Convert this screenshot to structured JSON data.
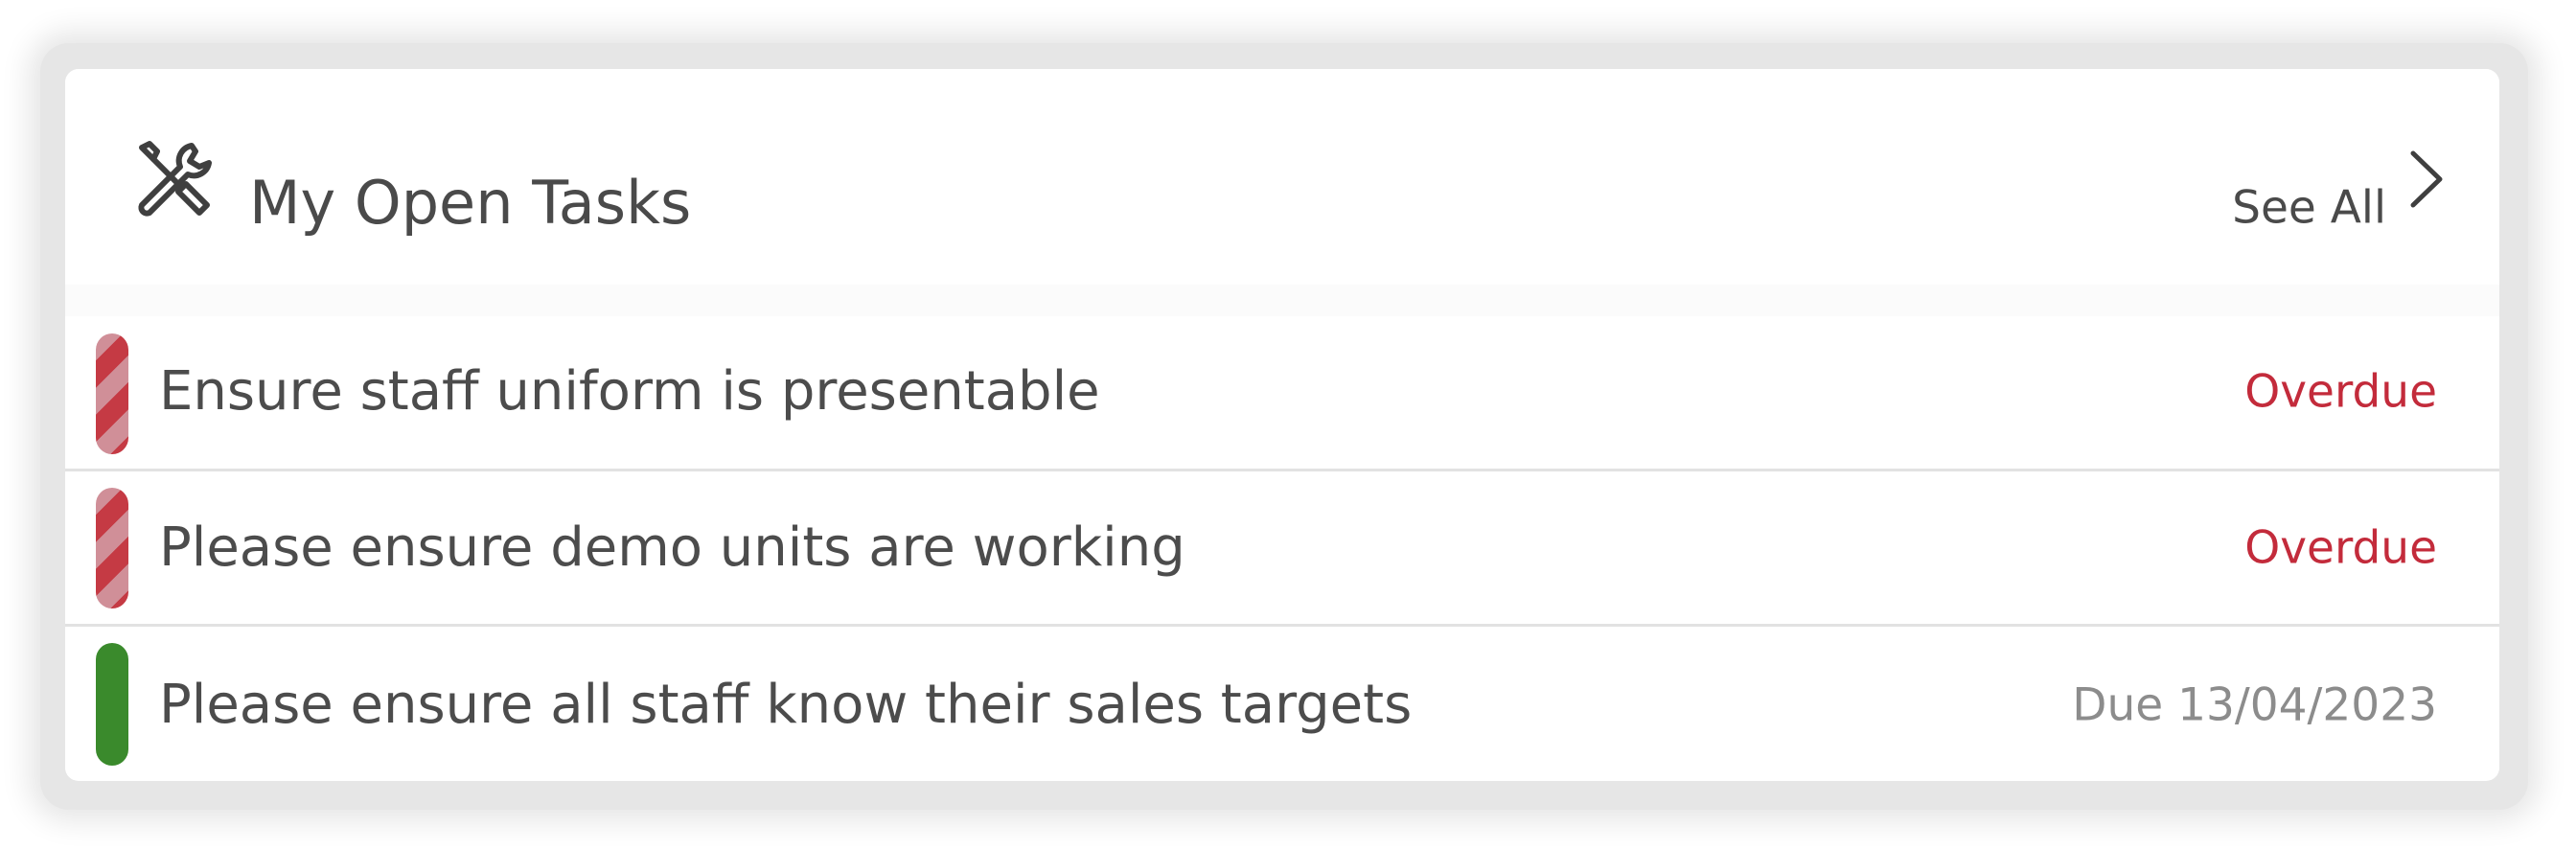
{
  "widget": {
    "title": "My Open Tasks",
    "icon": "tools-icon",
    "see_all_label": "See All",
    "see_all_icon": "chevron-right-icon"
  },
  "tasks": [
    {
      "title": "Ensure staff uniform is presentable",
      "due": "Overdue",
      "status": "overdue"
    },
    {
      "title": "Please ensure demo units are working",
      "due": "Overdue",
      "status": "overdue"
    },
    {
      "title": "Please ensure all staff know their sales targets",
      "due": "Due 13/04/2023",
      "status": "on-track"
    }
  ],
  "colors": {
    "overdue_text": "#c32b3b",
    "overdue_stripe_dark": "#c53a44",
    "overdue_stripe_light": "#d08f98",
    "on_track": "#3a8a2c",
    "due_text": "#8c8c8c",
    "text": "#4a4a4a"
  }
}
